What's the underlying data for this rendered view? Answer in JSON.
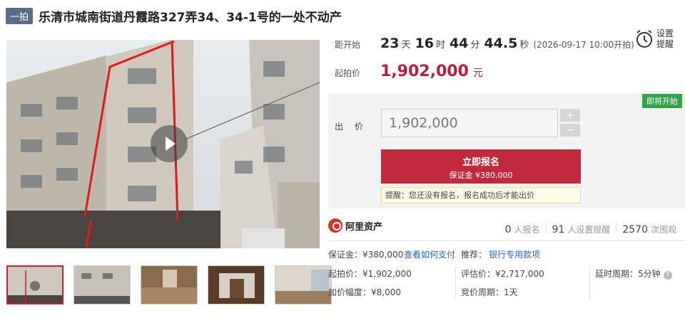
{
  "header": {
    "badge": "一拍",
    "title": "乐清市城南街道丹霞路327弄34、34-1号的一处不动产"
  },
  "countdown": {
    "label": "距开始",
    "days": "23",
    "days_unit": "天",
    "hours": "16",
    "hours_unit": "时",
    "minutes": "44",
    "minutes_unit": "分",
    "seconds": "44.5",
    "seconds_unit": "秒",
    "start_text": "(2026-09-17 10:00开拍)"
  },
  "reminder": {
    "label": "设置提醒",
    "icon": "alarm-clock-icon"
  },
  "start_price": {
    "label": "起拍价",
    "value": "1,902,000",
    "unit": "元"
  },
  "bid": {
    "status_tag": "即将开始",
    "label": "出 价",
    "input_value": "1,902,000",
    "plus": "+",
    "minus": "−",
    "signup_label": "立即报名",
    "deposit_line": "保证金 ¥380,000",
    "tip": "提醒：您还没有报名，报名成功后才能出价"
  },
  "platform": {
    "name": "阿里资产",
    "signups_num": "0",
    "signups_lbl": "人报名",
    "reminders_num": "91",
    "reminders_lbl": "人设置提醒",
    "views_num": "2570",
    "views_lbl": "次围观"
  },
  "details": {
    "deposit": "保证金：¥380,000",
    "how_to_pay": "查看如何支付",
    "recommend_label": "推荐：",
    "recommend_link": "银行专用款项",
    "start_price": "起拍价：¥1,902,000",
    "valuation": "评估价：¥2,717,000",
    "delay": "延时周期：5分钟",
    "increment": "加价幅度：¥8,000",
    "cycle": "竞价周期：1天"
  },
  "colors": {
    "accent": "#c12a3d",
    "price": "#b8203a",
    "badge": "#5b6b8a",
    "status": "#33a24a",
    "link": "#2a62b8"
  }
}
